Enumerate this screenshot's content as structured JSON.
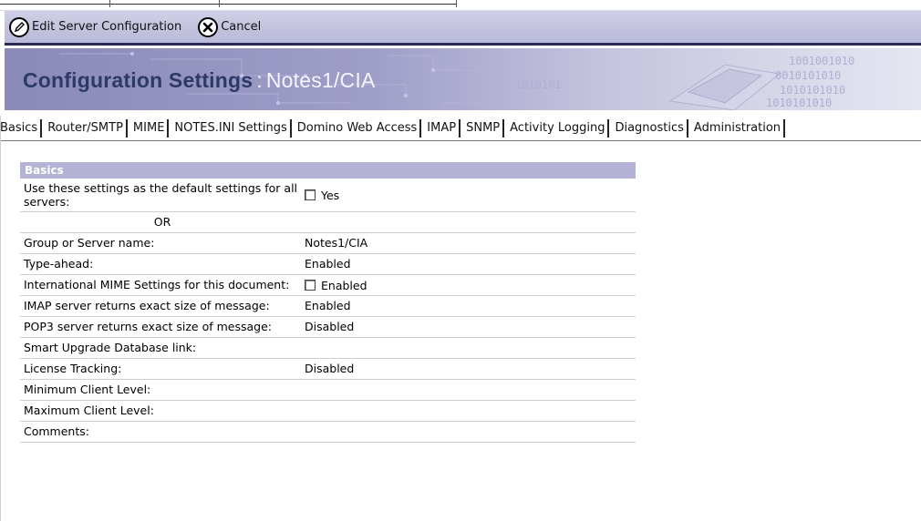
{
  "toolbar": {
    "edit_label": "Edit Server Configuration",
    "cancel_label": "Cancel"
  },
  "banner": {
    "title": "Configuration Settings",
    "separator": ":",
    "server": "Notes1/CIA"
  },
  "tabs": [
    {
      "label": "Basics"
    },
    {
      "label": "Router/SMTP"
    },
    {
      "label": "MIME"
    },
    {
      "label": "NOTES.INI Settings"
    },
    {
      "label": "Domino Web Access"
    },
    {
      "label": "IMAP"
    },
    {
      "label": "SNMP"
    },
    {
      "label": "Activity Logging"
    },
    {
      "label": "Diagnostics"
    },
    {
      "label": "Administration"
    }
  ],
  "basics": {
    "header": "Basics",
    "default_settings_label": "Use these settings as the default settings for all servers:",
    "default_settings_value": "Yes",
    "or_label": "OR",
    "group_server_label": "Group or Server name:",
    "group_server_value": "Notes1/CIA",
    "type_ahead_label": "Type-ahead:",
    "type_ahead_value": "Enabled",
    "intl_mime_label": "International MIME Settings for this document:",
    "intl_mime_value": "Enabled",
    "imap_size_label": "IMAP server returns exact size of message:",
    "imap_size_value": "Enabled",
    "pop3_size_label": "POP3 server returns exact size of message:",
    "pop3_size_value": "Disabled",
    "smart_upgrade_label": "Smart Upgrade Database link:",
    "license_label": "License Tracking:",
    "license_value": "Disabled",
    "min_client_label": "Minimum Client Level:",
    "max_client_label": "Maximum Client Level:",
    "comments_label": "Comments:"
  }
}
